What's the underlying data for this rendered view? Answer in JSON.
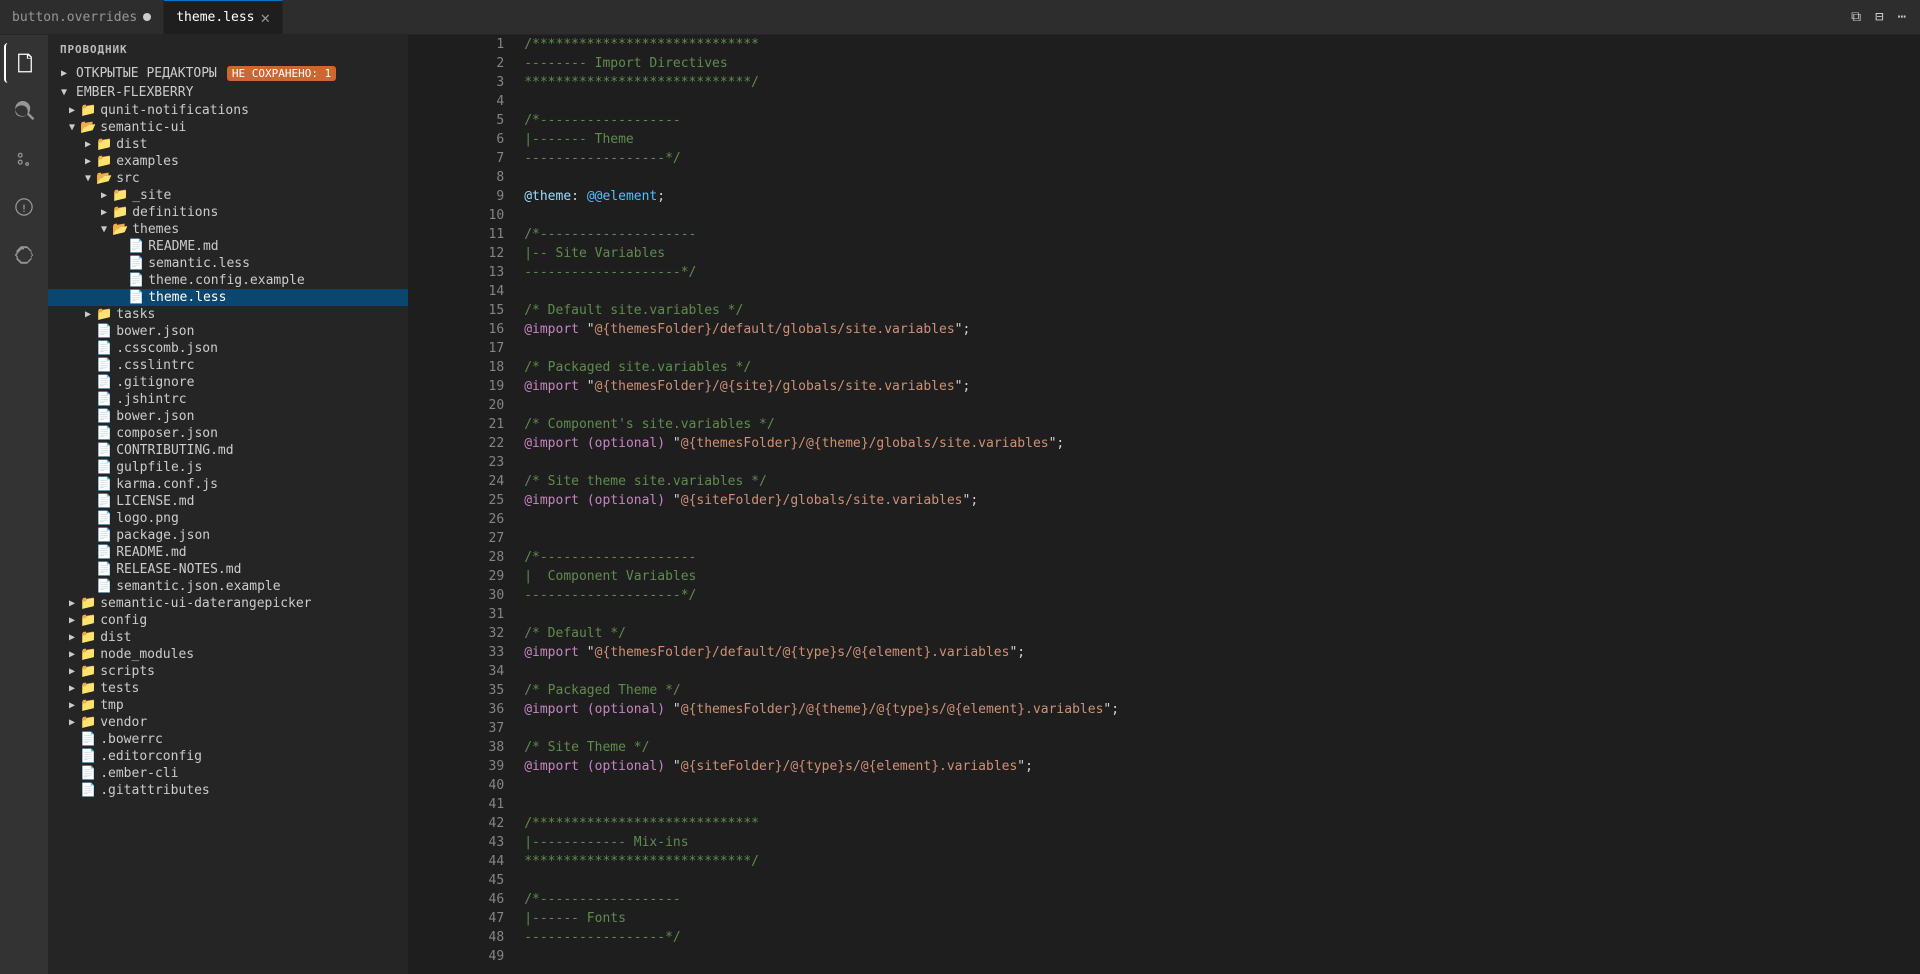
{
  "titleBar": {
    "text": "ПРОВОДНИК"
  },
  "tabs": [
    {
      "id": "button-overrides",
      "label": "button.overrides",
      "modified": true,
      "active": false
    },
    {
      "id": "theme-less",
      "label": "theme.less",
      "modified": false,
      "active": true
    }
  ],
  "sidebar": {
    "header": "ПРОВОДНИК",
    "openEditors": {
      "label": "ОТКРЫТЫЕ РЕДАКТОРЫ",
      "badge": "НЕ СОХРАНЕНО: 1"
    },
    "project": "EMBER-FLEXBERRY",
    "tree": [
      {
        "indent": 1,
        "type": "folder",
        "label": "qunit-notifications",
        "open": false
      },
      {
        "indent": 1,
        "type": "folder",
        "label": "semantic-ui",
        "open": true
      },
      {
        "indent": 2,
        "type": "folder",
        "label": "dist",
        "open": false
      },
      {
        "indent": 2,
        "type": "folder",
        "label": "examples",
        "open": false
      },
      {
        "indent": 2,
        "type": "folder",
        "label": "src",
        "open": true
      },
      {
        "indent": 3,
        "type": "folder",
        "label": "_site",
        "open": false
      },
      {
        "indent": 3,
        "type": "folder",
        "label": "definitions",
        "open": false
      },
      {
        "indent": 3,
        "type": "folder",
        "label": "themes",
        "open": true
      },
      {
        "indent": 4,
        "type": "file",
        "label": "README.md"
      },
      {
        "indent": 4,
        "type": "file",
        "label": "semantic.less"
      },
      {
        "indent": 4,
        "type": "file",
        "label": "theme.config.example"
      },
      {
        "indent": 4,
        "type": "file",
        "label": "theme.less",
        "selected": true
      },
      {
        "indent": 2,
        "type": "folder",
        "label": "tasks",
        "open": false
      },
      {
        "indent": 2,
        "type": "file",
        "label": "bower.json"
      },
      {
        "indent": 2,
        "type": "file",
        "label": ".csscomb.json"
      },
      {
        "indent": 2,
        "type": "file",
        "label": ".csslintrc"
      },
      {
        "indent": 2,
        "type": "file",
        "label": ".gitignore"
      },
      {
        "indent": 2,
        "type": "file",
        "label": ".jshintrc"
      },
      {
        "indent": 2,
        "type": "file",
        "label": "bower.json"
      },
      {
        "indent": 2,
        "type": "file",
        "label": "composer.json"
      },
      {
        "indent": 2,
        "type": "file",
        "label": "CONTRIBUTING.md"
      },
      {
        "indent": 2,
        "type": "file",
        "label": "gulpfile.js"
      },
      {
        "indent": 2,
        "type": "file",
        "label": "karma.conf.js"
      },
      {
        "indent": 2,
        "type": "file",
        "label": "LICENSE.md"
      },
      {
        "indent": 2,
        "type": "file",
        "label": "logo.png"
      },
      {
        "indent": 2,
        "type": "file",
        "label": "package.json"
      },
      {
        "indent": 2,
        "type": "file",
        "label": "README.md"
      },
      {
        "indent": 2,
        "type": "file",
        "label": "RELEASE-NOTES.md"
      },
      {
        "indent": 2,
        "type": "file",
        "label": "semantic.json.example"
      },
      {
        "indent": 1,
        "type": "folder",
        "label": "semantic-ui-daterangepicker",
        "open": false
      },
      {
        "indent": 1,
        "type": "folder",
        "label": "config",
        "open": false
      },
      {
        "indent": 1,
        "type": "folder",
        "label": "dist",
        "open": false
      },
      {
        "indent": 1,
        "type": "folder",
        "label": "node_modules",
        "open": false
      },
      {
        "indent": 1,
        "type": "folder",
        "label": "scripts",
        "open": false
      },
      {
        "indent": 1,
        "type": "folder",
        "label": "tests",
        "open": false
      },
      {
        "indent": 1,
        "type": "folder",
        "label": "tmp",
        "open": false
      },
      {
        "indent": 1,
        "type": "folder",
        "label": "vendor",
        "open": false
      },
      {
        "indent": 1,
        "type": "file",
        "label": ".bowerrc"
      },
      {
        "indent": 1,
        "type": "file",
        "label": ".editorconfig"
      },
      {
        "indent": 1,
        "type": "file",
        "label": ".ember-cli"
      },
      {
        "indent": 1,
        "type": "file",
        "label": ".gitattributes"
      }
    ]
  },
  "editor": {
    "filename": "theme.less",
    "lines": [
      {
        "num": 1,
        "tokens": [
          {
            "t": "comment",
            "v": "/*****************************"
          }
        ]
      },
      {
        "num": 2,
        "tokens": [
          {
            "t": "comment",
            "v": "-------- Import Directives"
          }
        ]
      },
      {
        "num": 3,
        "tokens": [
          {
            "t": "comment",
            "v": "*****************************/"
          }
        ]
      },
      {
        "num": 4,
        "tokens": []
      },
      {
        "num": 5,
        "tokens": [
          {
            "t": "comment",
            "v": "/*------------------"
          }
        ]
      },
      {
        "num": 6,
        "tokens": [
          {
            "t": "comment",
            "v": "|------- Theme"
          }
        ]
      },
      {
        "num": 7,
        "tokens": [
          {
            "t": "comment",
            "v": "------------------*/"
          }
        ]
      },
      {
        "num": 8,
        "tokens": []
      },
      {
        "num": 9,
        "tokens": [
          {
            "t": "variable",
            "v": "@theme"
          },
          {
            "t": "plain",
            "v": ": "
          },
          {
            "t": "value",
            "v": "@@element"
          },
          {
            "t": "plain",
            "v": ";"
          }
        ]
      },
      {
        "num": 10,
        "tokens": []
      },
      {
        "num": 11,
        "tokens": [
          {
            "t": "comment",
            "v": "/*--------------------"
          }
        ]
      },
      {
        "num": 12,
        "tokens": [
          {
            "t": "comment",
            "v": "|-- Site Variables"
          }
        ]
      },
      {
        "num": 13,
        "tokens": [
          {
            "t": "comment",
            "v": "--------------------*/"
          }
        ]
      },
      {
        "num": 14,
        "tokens": []
      },
      {
        "num": 15,
        "tokens": [
          {
            "t": "comment",
            "v": "/* Default site.variables */"
          }
        ]
      },
      {
        "num": 16,
        "tokens": [
          {
            "t": "keyword",
            "v": "@import"
          },
          {
            "t": "plain",
            "v": " \""
          },
          {
            "t": "string",
            "v": "@{themesFolder}/default/globals/site.variables"
          },
          {
            "t": "plain",
            "v": "\";"
          }
        ]
      },
      {
        "num": 17,
        "tokens": []
      },
      {
        "num": 18,
        "tokens": [
          {
            "t": "comment",
            "v": "/* Packaged site.variables */"
          }
        ]
      },
      {
        "num": 19,
        "tokens": [
          {
            "t": "keyword",
            "v": "@import"
          },
          {
            "t": "plain",
            "v": " \""
          },
          {
            "t": "string",
            "v": "@{themesFolder}/@{site}/globals/site.variables"
          },
          {
            "t": "plain",
            "v": "\";"
          }
        ]
      },
      {
        "num": 20,
        "tokens": []
      },
      {
        "num": 21,
        "tokens": [
          {
            "t": "comment",
            "v": "/* Component's site.variables */"
          }
        ]
      },
      {
        "num": 22,
        "tokens": [
          {
            "t": "keyword",
            "v": "@import"
          },
          {
            "t": "plain",
            "v": " "
          },
          {
            "t": "optional",
            "v": "(optional)"
          },
          {
            "t": "plain",
            "v": " \""
          },
          {
            "t": "string",
            "v": "@{themesFolder}/@{theme}/globals/site.variables"
          },
          {
            "t": "plain",
            "v": "\";"
          }
        ]
      },
      {
        "num": 23,
        "tokens": []
      },
      {
        "num": 24,
        "tokens": [
          {
            "t": "comment",
            "v": "/* Site theme site.variables */"
          }
        ]
      },
      {
        "num": 25,
        "tokens": [
          {
            "t": "keyword",
            "v": "@import"
          },
          {
            "t": "plain",
            "v": " "
          },
          {
            "t": "optional",
            "v": "(optional)"
          },
          {
            "t": "plain",
            "v": " \""
          },
          {
            "t": "string",
            "v": "@{siteFolder}/globals/site.variables"
          },
          {
            "t": "plain",
            "v": "\";"
          }
        ]
      },
      {
        "num": 26,
        "tokens": []
      },
      {
        "num": 27,
        "tokens": []
      },
      {
        "num": 28,
        "tokens": [
          {
            "t": "comment",
            "v": "/*--------------------"
          }
        ]
      },
      {
        "num": 29,
        "tokens": [
          {
            "t": "comment",
            "v": "|  Component Variables"
          }
        ]
      },
      {
        "num": 30,
        "tokens": [
          {
            "t": "comment",
            "v": "--------------------*/"
          }
        ]
      },
      {
        "num": 31,
        "tokens": []
      },
      {
        "num": 32,
        "tokens": [
          {
            "t": "comment",
            "v": "/* Default */"
          }
        ]
      },
      {
        "num": 33,
        "tokens": [
          {
            "t": "keyword",
            "v": "@import"
          },
          {
            "t": "plain",
            "v": " \""
          },
          {
            "t": "string",
            "v": "@{themesFolder}/default/@{type}s/@{element}.variables"
          },
          {
            "t": "plain",
            "v": "\";"
          }
        ]
      },
      {
        "num": 34,
        "tokens": []
      },
      {
        "num": 35,
        "tokens": [
          {
            "t": "comment",
            "v": "/* Packaged Theme */"
          }
        ]
      },
      {
        "num": 36,
        "tokens": [
          {
            "t": "keyword",
            "v": "@import"
          },
          {
            "t": "plain",
            "v": " "
          },
          {
            "t": "optional",
            "v": "(optional)"
          },
          {
            "t": "plain",
            "v": " \""
          },
          {
            "t": "string",
            "v": "@{themesFolder}/@{theme}/@{type}s/@{element}.variables"
          },
          {
            "t": "plain",
            "v": "\";"
          }
        ]
      },
      {
        "num": 37,
        "tokens": []
      },
      {
        "num": 38,
        "tokens": [
          {
            "t": "comment",
            "v": "/* Site Theme */"
          }
        ]
      },
      {
        "num": 39,
        "tokens": [
          {
            "t": "keyword",
            "v": "@import"
          },
          {
            "t": "plain",
            "v": " "
          },
          {
            "t": "optional",
            "v": "(optional)"
          },
          {
            "t": "plain",
            "v": " \""
          },
          {
            "t": "string",
            "v": "@{siteFolder}/@{type}s/@{element}.variables"
          },
          {
            "t": "plain",
            "v": "\";"
          }
        ]
      },
      {
        "num": 40,
        "tokens": []
      },
      {
        "num": 41,
        "tokens": []
      },
      {
        "num": 42,
        "tokens": [
          {
            "t": "comment",
            "v": "/*****************************"
          }
        ]
      },
      {
        "num": 43,
        "tokens": [
          {
            "t": "comment",
            "v": "|------------ Mix-ins"
          }
        ]
      },
      {
        "num": 44,
        "tokens": [
          {
            "t": "comment",
            "v": "*****************************/"
          }
        ]
      },
      {
        "num": 45,
        "tokens": []
      },
      {
        "num": 46,
        "tokens": [
          {
            "t": "comment",
            "v": "/*------------------"
          }
        ]
      },
      {
        "num": 47,
        "tokens": [
          {
            "t": "comment",
            "v": "|------ Fonts"
          }
        ]
      },
      {
        "num": 48,
        "tokens": [
          {
            "t": "comment",
            "v": "------------------*/"
          }
        ]
      },
      {
        "num": 49,
        "tokens": []
      }
    ]
  },
  "activityBar": {
    "icons": [
      "📁",
      "🔍",
      "⎇",
      "🐛",
      "🧩"
    ]
  }
}
